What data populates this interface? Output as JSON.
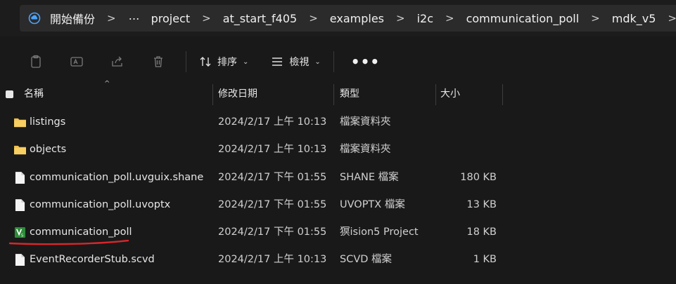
{
  "address_bar": {
    "root": "開始備份",
    "ellipsis": "⋯",
    "crumbs": [
      "project",
      "at_start_f405",
      "examples",
      "i2c",
      "communication_poll",
      "mdk_v5"
    ],
    "separator": ">"
  },
  "toolbar": {
    "sort_label": "排序",
    "view_label": "檢視",
    "more_label": "•••",
    "chevron": "⌄"
  },
  "columns": {
    "name": "名稱",
    "date": "修改日期",
    "type": "類型",
    "size": "大小",
    "sort_caret": "^"
  },
  "files": [
    {
      "name": "listings",
      "date": "2024/2/17 上午 10:13",
      "type": "檔案資料夾",
      "size": "",
      "icon": "folder-icon"
    },
    {
      "name": "objects",
      "date": "2024/2/17 上午 10:13",
      "type": "檔案資料夾",
      "size": "",
      "icon": "folder-icon"
    },
    {
      "name": "communication_poll.uvguix.shane",
      "date": "2024/2/17 下午 01:55",
      "type": "SHANE 檔案",
      "size": "180 KB",
      "icon": "file-icon"
    },
    {
      "name": "communication_poll.uvoptx",
      "date": "2024/2/17 下午 01:55",
      "type": "UVOPTX 檔案",
      "size": "13 KB",
      "icon": "file-icon"
    },
    {
      "name": "communication_poll",
      "date": "2024/2/17 下午 01:55",
      "type": "猽ision5 Project",
      "size": "18 KB",
      "icon": "uvision-project-icon"
    },
    {
      "name": "EventRecorderStub.scvd",
      "date": "2024/2/17 上午 10:13",
      "type": "SCVD 檔案",
      "size": "1 KB",
      "icon": "file-icon"
    }
  ],
  "colors": {
    "background": "#191919",
    "folder": "#f2c14e",
    "annotation_underline": "#d8262b",
    "uvision_green": "#2e8b3a"
  }
}
